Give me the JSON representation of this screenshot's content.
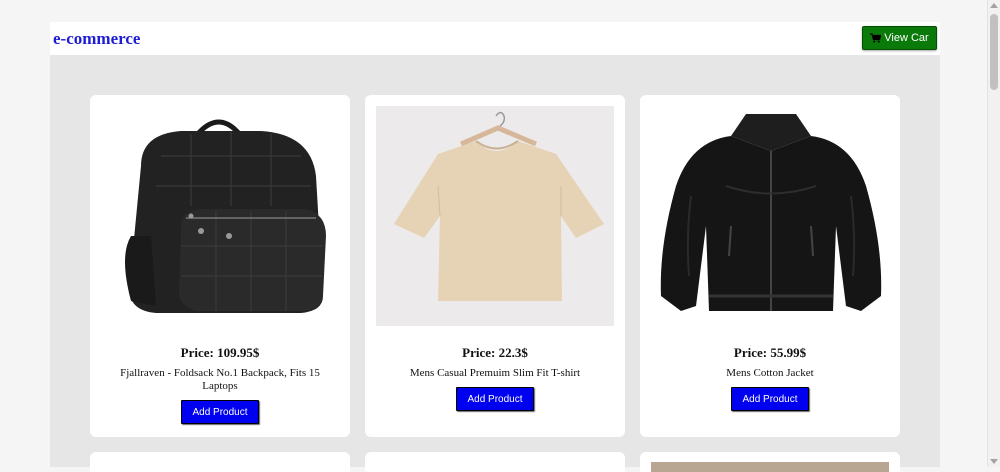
{
  "header": {
    "brand": "e-commerce",
    "view_cart_label": "View Car"
  },
  "products": [
    {
      "price": "Price: 109.95$",
      "title": "Fjallraven - Foldsack No.1 Backpack, Fits 15 Laptops",
      "add_label": "Add Product",
      "image": "black-backpack"
    },
    {
      "price": "Price: 22.3$",
      "title": "Mens Casual Premuim Slim Fit T-shirt",
      "add_label": "Add Product",
      "image": "beige-tshirt-on-hanger"
    },
    {
      "price": "Price: 55.99$",
      "title": "Mens Cotton Jacket",
      "add_label": "Add Product",
      "image": "black-leather-jacket"
    }
  ],
  "colors": {
    "brand": "#1d1dd6",
    "cart_button": "#0a7a0a",
    "add_button": "#0000f0",
    "page_bg": "#e6e6e6"
  }
}
